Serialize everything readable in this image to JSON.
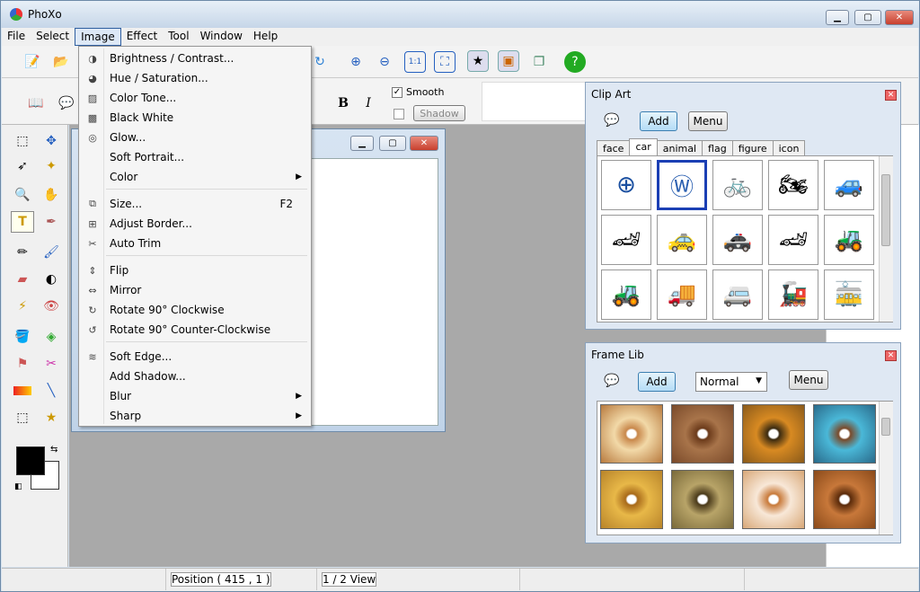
{
  "app": {
    "title": "PhoXo"
  },
  "menubar": [
    "File",
    "Select",
    "Image",
    "Effect",
    "Tool",
    "Window",
    "Help"
  ],
  "toolbar2": {
    "smooth_label": "Smooth",
    "shadow_label": "Shadow"
  },
  "image_menu": {
    "items": [
      {
        "label": "Brightness / Contrast...",
        "icon": "brightness-icon"
      },
      {
        "label": "Hue / Saturation...",
        "icon": "hue-icon"
      },
      {
        "label": "Color Tone...",
        "icon": "color-tone-icon"
      },
      {
        "label": "Black White",
        "icon": "black-white-icon"
      },
      {
        "label": "Glow...",
        "icon": "glow-icon"
      },
      {
        "label": "Soft Portrait...",
        "icon": ""
      },
      {
        "label": "Color",
        "icon": "",
        "submenu": true
      },
      {
        "label": "Size...",
        "icon": "size-icon",
        "shortcut": "F2"
      },
      {
        "label": "Adjust Border...",
        "icon": "border-icon"
      },
      {
        "label": "Auto Trim",
        "icon": "trim-icon"
      },
      {
        "label": "Flip",
        "icon": "flip-icon"
      },
      {
        "label": "Mirror",
        "icon": "mirror-icon"
      },
      {
        "label": "Rotate 90° Clockwise",
        "icon": "rotate-cw-icon"
      },
      {
        "label": "Rotate 90° Counter-Clockwise",
        "icon": "rotate-ccw-icon"
      },
      {
        "label": "Soft Edge...",
        "icon": "soft-edge-icon"
      },
      {
        "label": "Add Shadow...",
        "icon": ""
      },
      {
        "label": "Blur",
        "icon": "",
        "submenu": true
      },
      {
        "label": "Sharp",
        "icon": "",
        "submenu": true
      }
    ]
  },
  "clipart": {
    "title": "Clip Art",
    "add_label": "Add",
    "menu_label": "Menu",
    "tabs": [
      "face",
      "car",
      "animal",
      "flag",
      "figure",
      "icon"
    ],
    "active_tab": "car",
    "items": [
      "bmw-logo",
      "vw-logo",
      "bicycle",
      "motorcycle",
      "suv",
      "red-sports-car",
      "yellow-taxi",
      "police-car",
      "race-car",
      "bulldozer",
      "tractor",
      "truck",
      "rv",
      "locomotive",
      "tram"
    ]
  },
  "framelib": {
    "title": "Frame Lib",
    "add_label": "Add",
    "menu_label": "Menu",
    "mode": "Normal"
  },
  "status": {
    "position": "Position ( 415 , 1 )",
    "view": "1 / 2 View"
  },
  "colors": {
    "foreground": "#000000",
    "background": "#ffffff"
  }
}
